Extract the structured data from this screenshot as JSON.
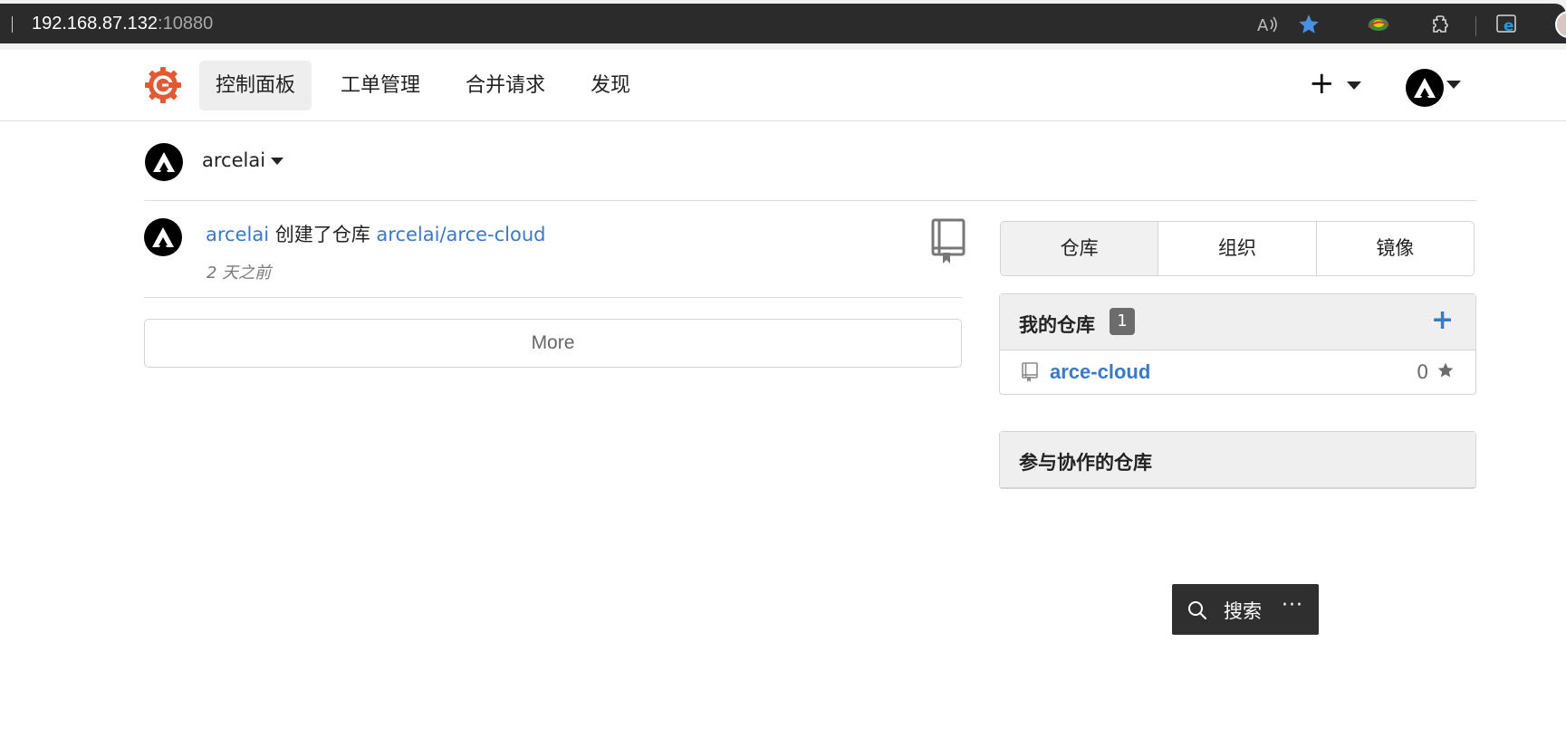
{
  "browser": {
    "url_host": "192.168.87.132",
    "url_port": ":10880",
    "icons": [
      "read-aloud-icon",
      "favorite-star-icon",
      "extension-globe-icon",
      "puzzle-extensions-icon",
      "edge-ie-mode-icon",
      "profile-avatar-icon"
    ]
  },
  "header": {
    "nav": [
      {
        "label": "控制面板",
        "active": true
      },
      {
        "label": "工单管理"
      },
      {
        "label": "合并请求"
      },
      {
        "label": "发现"
      }
    ],
    "create_label": "+"
  },
  "context": {
    "username": "arcelai"
  },
  "feed": {
    "actor": "arcelai",
    "action": "创建了仓库",
    "repo": "arcelai/arce-cloud",
    "time": "2 天之前",
    "more_label": "More"
  },
  "sidebar": {
    "tabs": [
      {
        "label": "仓库",
        "active": true
      },
      {
        "label": "组织"
      },
      {
        "label": "镜像"
      }
    ],
    "my_repos": {
      "title": "我的仓库",
      "count": "1",
      "add_label": "+",
      "items": [
        {
          "name": "arce-cloud",
          "stars": "0"
        }
      ]
    },
    "collab_repos": {
      "title": "参与协作的仓库"
    }
  },
  "floating_search": {
    "label": "搜索",
    "more": "···"
  },
  "colors": {
    "link": "#3a79c6",
    "logo": "#e05b33",
    "badge": "#6c6c6c",
    "float_bg": "#2f2f2f"
  }
}
